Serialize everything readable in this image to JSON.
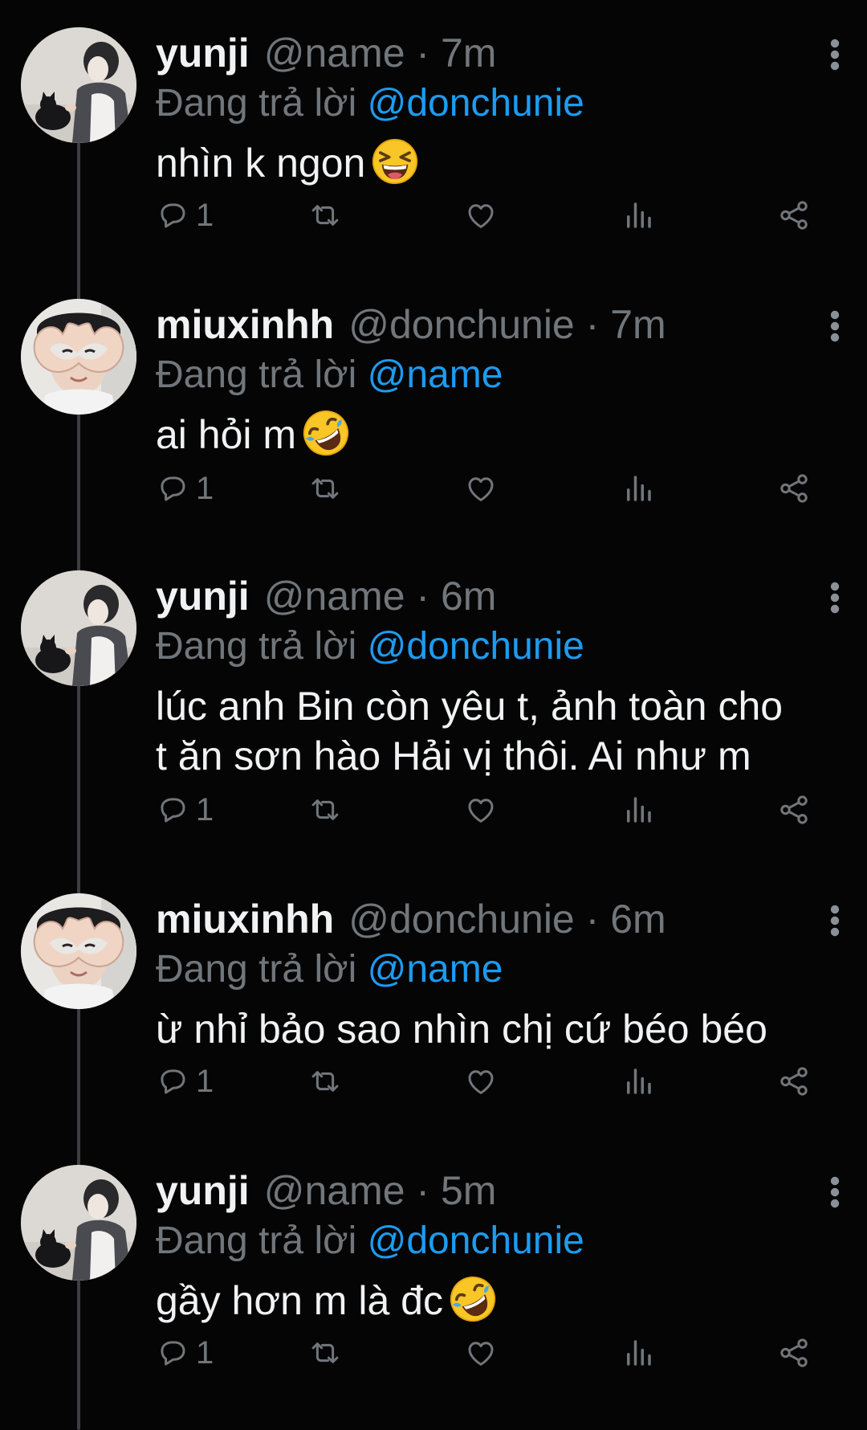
{
  "reply_prefix": "Đang trả lời",
  "tweets": [
    {
      "name": "yunji",
      "handle": "@name",
      "time": "7m",
      "reply_to": "@donchunie",
      "text": "nhìn k ngon",
      "emoji": "grinning-squinting-face-emoji",
      "avatar": "avatar-person-with-cat",
      "reply_count": "1"
    },
    {
      "name": "miuxinhh",
      "handle": "@donchunie",
      "time": "7m",
      "reply_to": "@name",
      "text": "ai hỏi m",
      "emoji": "rolling-on-floor-laughing-emoji",
      "avatar": "avatar-heart-hands",
      "reply_count": "1"
    },
    {
      "name": "yunji",
      "handle": "@name",
      "time": "6m",
      "reply_to": "@donchunie",
      "text_line1": "lúc anh Bin còn yêu t, ảnh toàn cho",
      "text_line2": "t ăn sơn hào Hải vị thôi. Ai như m",
      "avatar": "avatar-person-with-cat",
      "reply_count": "1"
    },
    {
      "name": "miuxinhh",
      "handle": "@donchunie",
      "time": "6m",
      "reply_to": "@name",
      "text": "ừ nhỉ bảo sao nhìn chị cứ béo béo",
      "avatar": "avatar-heart-hands",
      "reply_count": "1"
    },
    {
      "name": "yunji",
      "handle": "@name",
      "time": "5m",
      "reply_to": "@donchunie",
      "text": "gầy hơn m là đc",
      "emoji": "rolling-on-floor-laughing-emoji",
      "avatar": "avatar-person-with-cat",
      "reply_count": "1"
    }
  ],
  "colors": {
    "background": "#050505",
    "text": "#f1f2f3",
    "muted": "#71767b",
    "mention": "#1d9bf0",
    "thread_line": "#3b3f43"
  },
  "icons": [
    "reply-icon",
    "retweet-icon",
    "like-icon",
    "views-icon",
    "share-icon",
    "more-options-icon"
  ]
}
